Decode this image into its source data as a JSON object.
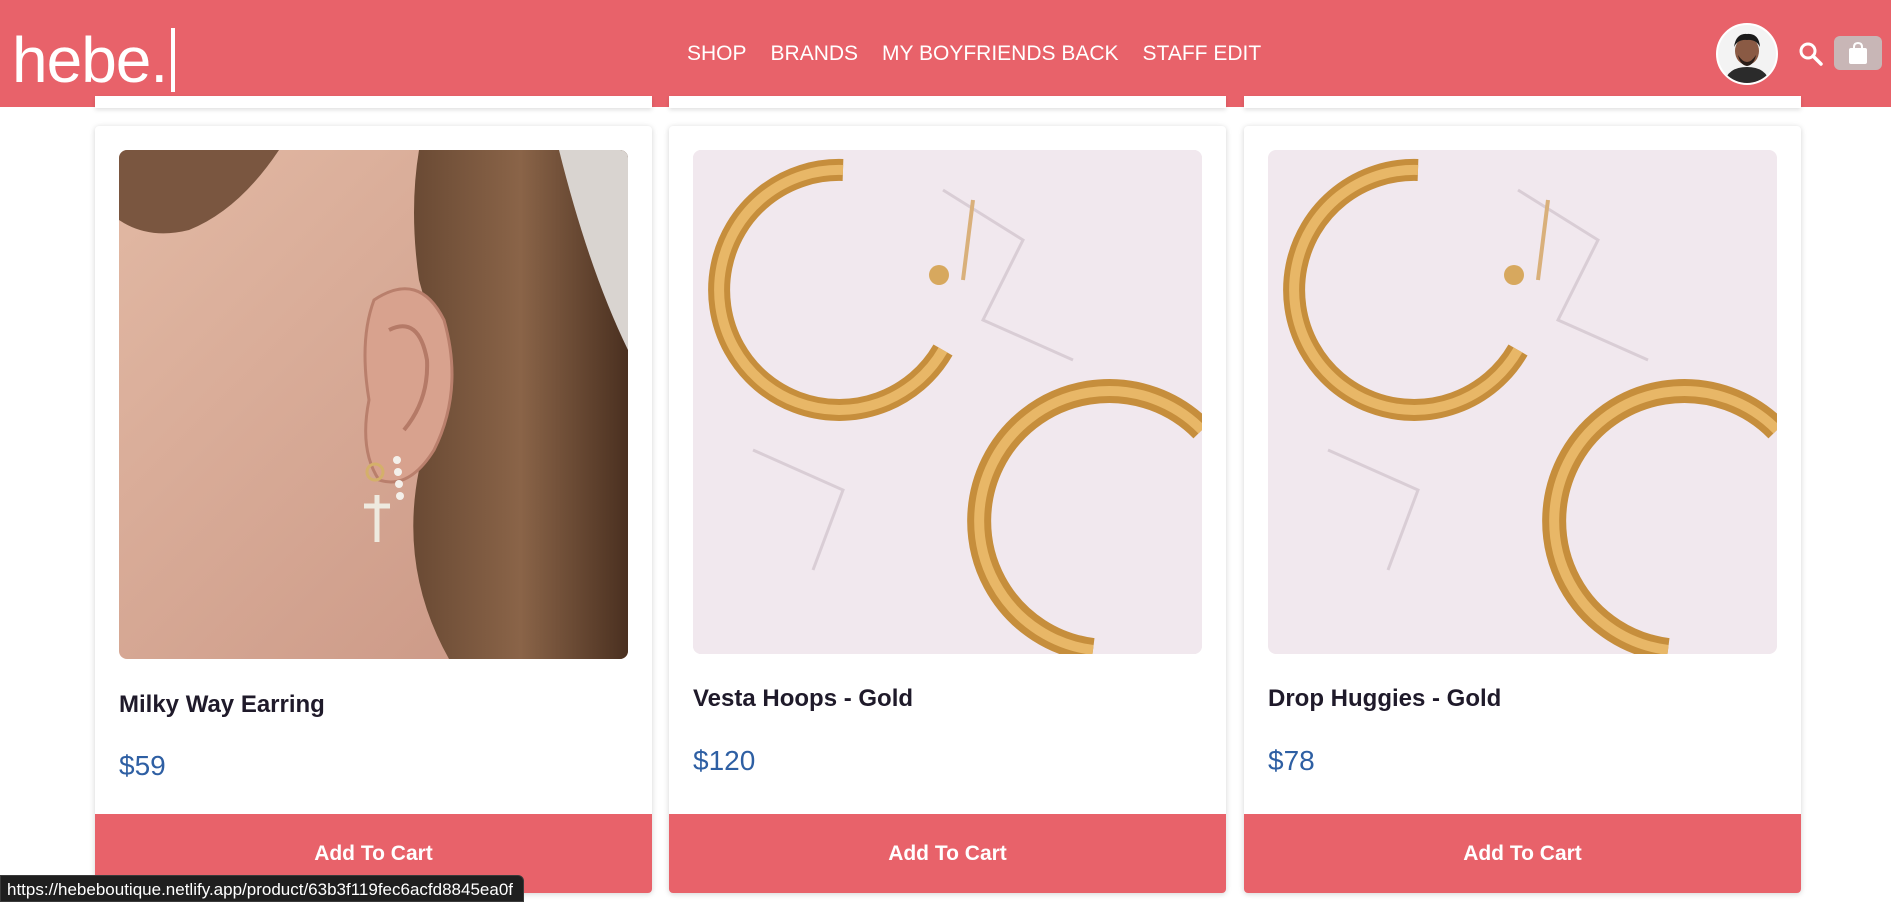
{
  "brand": {
    "logo_text": "hebe."
  },
  "nav": {
    "items": [
      {
        "label": "SHOP"
      },
      {
        "label": "BRANDS"
      },
      {
        "label": "MY BOYFRIENDS BACK"
      },
      {
        "label": "STAFF EDIT"
      }
    ]
  },
  "header_icons": [
    "avatar",
    "search-icon",
    "shopping-bag-icon"
  ],
  "products": [
    {
      "title": "Milky Way Earring",
      "price": "$59",
      "button_label": "Add To Cart"
    },
    {
      "title": "Vesta Hoops - Gold",
      "price": "$120",
      "button_label": "Add To Cart"
    },
    {
      "title": "Drop Huggies - Gold",
      "price": "$78",
      "button_label": "Add To Cart"
    }
  ],
  "status_bar": {
    "url": "https://hebeboutique.netlify.app/product/63b3f119fec6acfd8845ea0f"
  },
  "colors": {
    "accent": "#e8626a",
    "price": "#2e5fa3",
    "title": "#1f1a2a"
  }
}
